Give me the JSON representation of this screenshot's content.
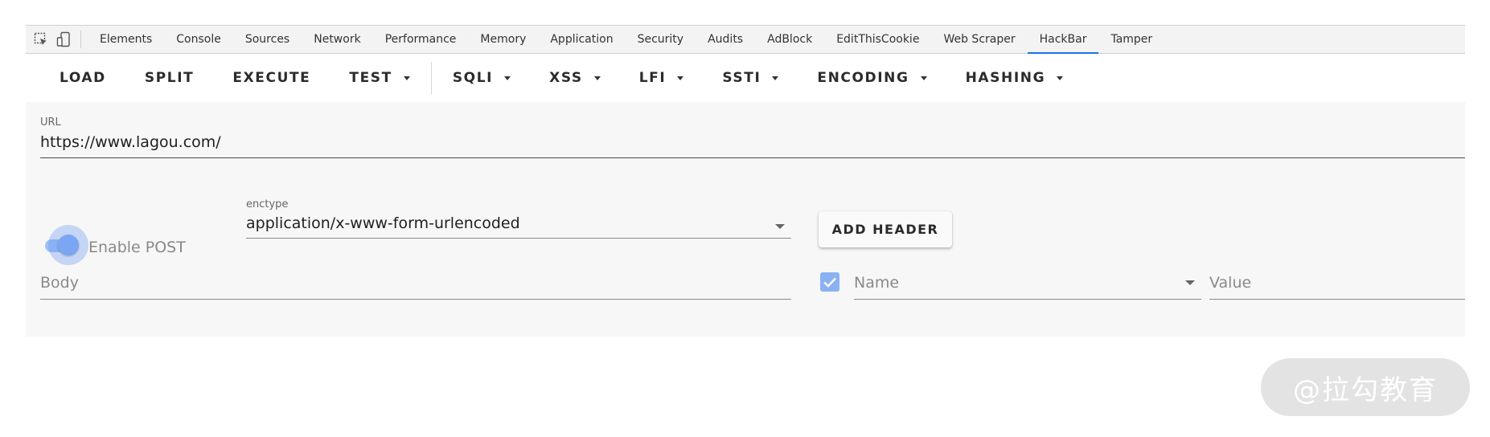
{
  "devtools": {
    "tabs": [
      {
        "label": "Elements"
      },
      {
        "label": "Console"
      },
      {
        "label": "Sources"
      },
      {
        "label": "Network"
      },
      {
        "label": "Performance"
      },
      {
        "label": "Memory"
      },
      {
        "label": "Application"
      },
      {
        "label": "Security"
      },
      {
        "label": "Audits"
      },
      {
        "label": "AdBlock"
      },
      {
        "label": "EditThisCookie"
      },
      {
        "label": "Web Scraper"
      },
      {
        "label": "HackBar",
        "active": true
      },
      {
        "label": "Tamper"
      }
    ],
    "icons": [
      "inspect-element-icon",
      "device-toolbar-icon"
    ],
    "accent": "#1a73e8"
  },
  "hackbar": {
    "toolbar": {
      "load": "LOAD",
      "split": "SPLIT",
      "execute": "EXECUTE",
      "test": "TEST",
      "sqli": "SQLI",
      "xss": "XSS",
      "lfi": "LFI",
      "ssti": "SSTI",
      "encoding": "ENCODING",
      "hashing": "HASHING"
    },
    "url": {
      "label": "URL",
      "value": "https://www.lagou.com/"
    },
    "post": {
      "label": "Enable POST",
      "enabled": true
    },
    "enctype": {
      "label": "enctype",
      "value": "application/x-www-form-urlencoded"
    },
    "add_header": "ADD HEADER",
    "body": {
      "placeholder": "Body"
    },
    "header_row": {
      "checked": true,
      "name_placeholder": "Name",
      "value_placeholder": "Value"
    }
  },
  "watermark": "@拉勾教育"
}
